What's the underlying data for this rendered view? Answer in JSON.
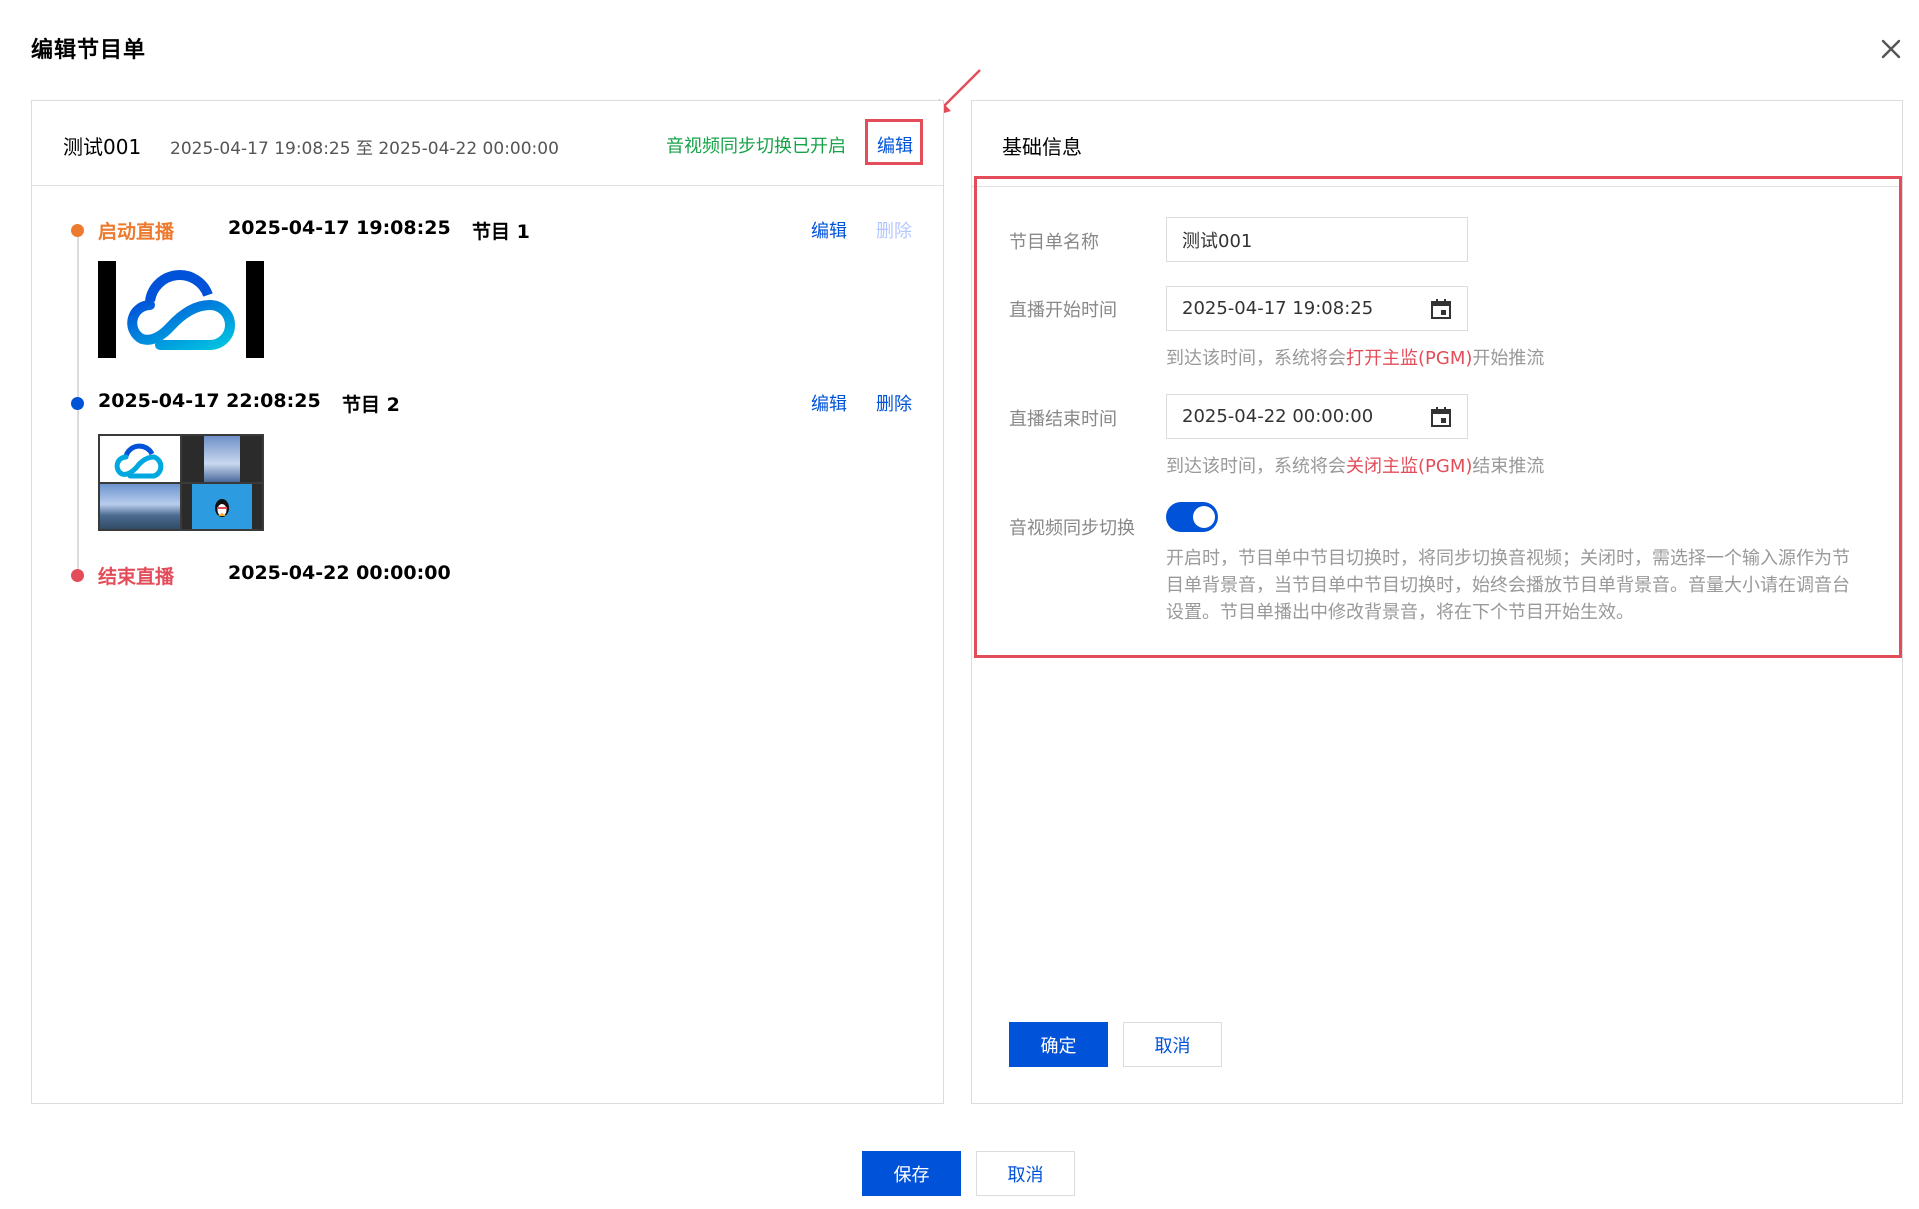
{
  "dialog": {
    "title": "编辑节目单"
  },
  "left": {
    "playlist_name": "测试001",
    "playlist_range": "2025-04-17 19:08:25 至 2025-04-22 00:00:00",
    "sync_status": "音视频同步切换已开启",
    "edit_label": "编辑",
    "timeline": [
      {
        "label": "启动直播",
        "time": "2025-04-17 19:08:25",
        "program": "节目 1",
        "edit": "编辑",
        "delete": "删除",
        "delete_enabled": false,
        "color": "#ed7b2f"
      },
      {
        "label": "",
        "time": "2025-04-17 22:08:25",
        "program": "节目 2",
        "edit": "编辑",
        "delete": "删除",
        "delete_enabled": true,
        "color": "#0052d9"
      },
      {
        "label": "结束直播",
        "time": "2025-04-22 00:00:00",
        "color": "#e34d59"
      }
    ]
  },
  "right": {
    "title": "基础信息",
    "name_label": "节目单名称",
    "name_value": "测试001",
    "start_label": "直播开始时间",
    "start_value": "2025-04-17 19:08:25",
    "start_hint_pre": "到达该时间，系统将会",
    "start_hint_red": "打开主监(PGM)",
    "start_hint_post": "开始推流",
    "end_label": "直播结束时间",
    "end_value": "2025-04-22 00:00:00",
    "end_hint_pre": "到达该时间，系统将会",
    "end_hint_red": "关闭主监(PGM)",
    "end_hint_post": "结束推流",
    "sync_label": "音视频同步切换",
    "sync_on": true,
    "sync_desc_1": "开启时，节目单中节目切换时，将同步切换音视频；关闭时，需选择一个输入源作为节",
    "sync_desc_2": "目单背景音，当节目单中节目切换时，始终会播放节目单背景音。音量大小请在调音台",
    "sync_desc_3": "设置。节目单播出中修改背景音，将在下个节目开始生效。",
    "confirm": "确定",
    "cancel": "取消"
  },
  "footer": {
    "save": "保存",
    "cancel": "取消"
  },
  "colors": {
    "primary": "#0052d9",
    "success": "#17a34a",
    "danger": "#e34d59",
    "warning": "#ed7b2f"
  }
}
